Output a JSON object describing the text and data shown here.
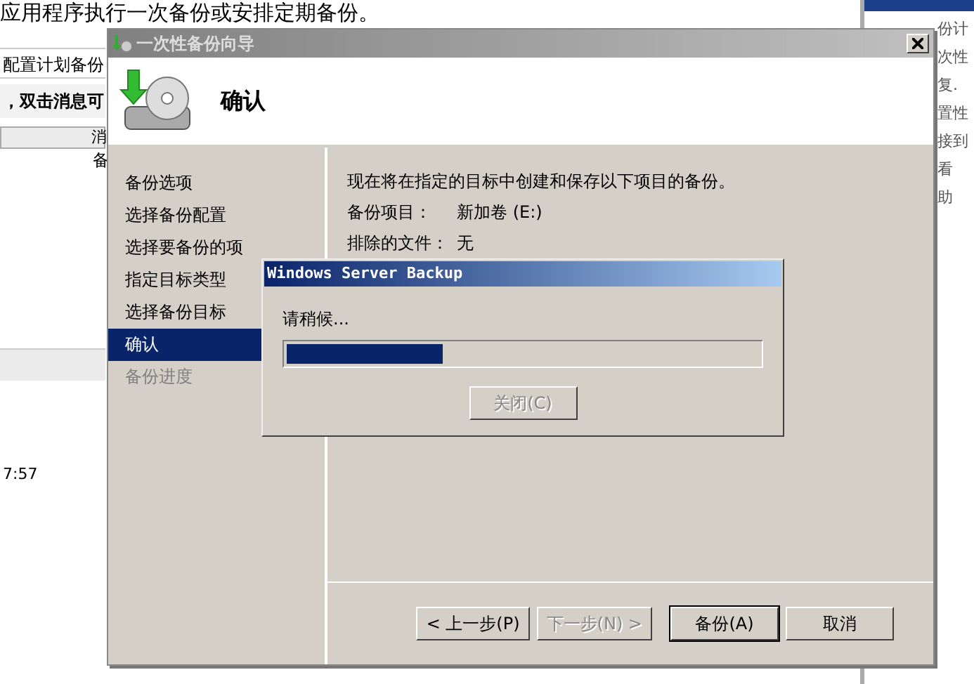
{
  "background_app": {
    "description": "应用程序执行一次备份或安排定期备份。",
    "configure_link": "配置计划备份",
    "message_hint": "，双击消息可",
    "column_header": "消",
    "cell": "备",
    "time": "7:57",
    "actions": [
      "份计",
      "次性",
      "复.",
      "置性",
      "接到",
      "看",
      "助"
    ]
  },
  "wizard": {
    "title": "一次性备份向导",
    "page_title": "确认",
    "steps": [
      {
        "label": "备份选项",
        "selected": false,
        "disabled": false
      },
      {
        "label": "选择备份配置",
        "selected": false,
        "disabled": false
      },
      {
        "label": "选择要备份的项",
        "selected": false,
        "disabled": false
      },
      {
        "label": "指定目标类型",
        "selected": false,
        "disabled": false
      },
      {
        "label": "选择备份目标",
        "selected": false,
        "disabled": false
      },
      {
        "label": "确认",
        "selected": true,
        "disabled": false
      },
      {
        "label": "备份进度",
        "selected": false,
        "disabled": true
      }
    ],
    "summary": "现在将在指定的目标中创建和保存以下项目的备份。",
    "details": [
      {
        "label": "备份项目：",
        "value": "新加卷 (E:)"
      },
      {
        "label": "排除的文件：",
        "value": "无"
      }
    ],
    "buttons": [
      {
        "label": "< 上一步(P)",
        "disabled": false,
        "default": false
      },
      {
        "label": "下一步(N) >",
        "disabled": true,
        "default": false
      },
      {
        "label": "备份(A)",
        "disabled": false,
        "default": true
      },
      {
        "label": "取消",
        "disabled": false,
        "default": false
      }
    ]
  },
  "progress_dialog": {
    "title": "Windows Server Backup",
    "message": "请稍候...",
    "level": 0.33,
    "buttons": [
      {
        "label": "关闭(C)",
        "disabled": true
      }
    ]
  }
}
